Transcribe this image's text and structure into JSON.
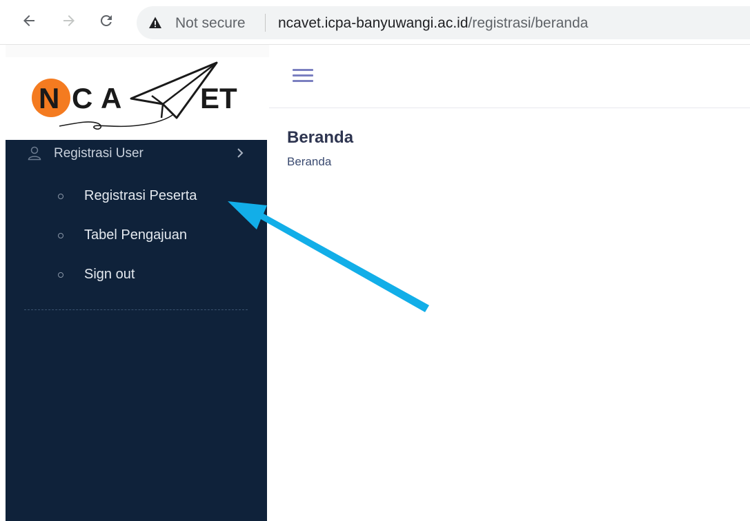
{
  "browser": {
    "back_icon": "arrow-left-icon",
    "forward_icon": "arrow-right-icon",
    "reload_icon": "reload-icon",
    "security_icon": "warning-triangle-icon",
    "security_label": "Not secure",
    "url_host": "ncavet.icpa-banyuwangi.ac.id",
    "url_path": "/registrasi/beranda"
  },
  "logo": {
    "text": "NCAVET",
    "colors": {
      "n_circle": "#f47b20",
      "letters": "#1a1a1a"
    }
  },
  "sidebar": {
    "background": "#0f223a",
    "parent": {
      "label": "Registrasi User",
      "icon": "user-icon",
      "chevron": "chevron-right-icon"
    },
    "items": [
      {
        "label": "Registrasi Peserta"
      },
      {
        "label": "Tabel Pengajuan"
      },
      {
        "label": "Sign out"
      }
    ]
  },
  "topbar": {
    "menu_icon": "hamburger-icon"
  },
  "main": {
    "title": "Beranda",
    "breadcrumb": "Beranda"
  },
  "annotation": {
    "type": "arrow",
    "color": "#12aee8",
    "points_to": "Registrasi Peserta"
  }
}
